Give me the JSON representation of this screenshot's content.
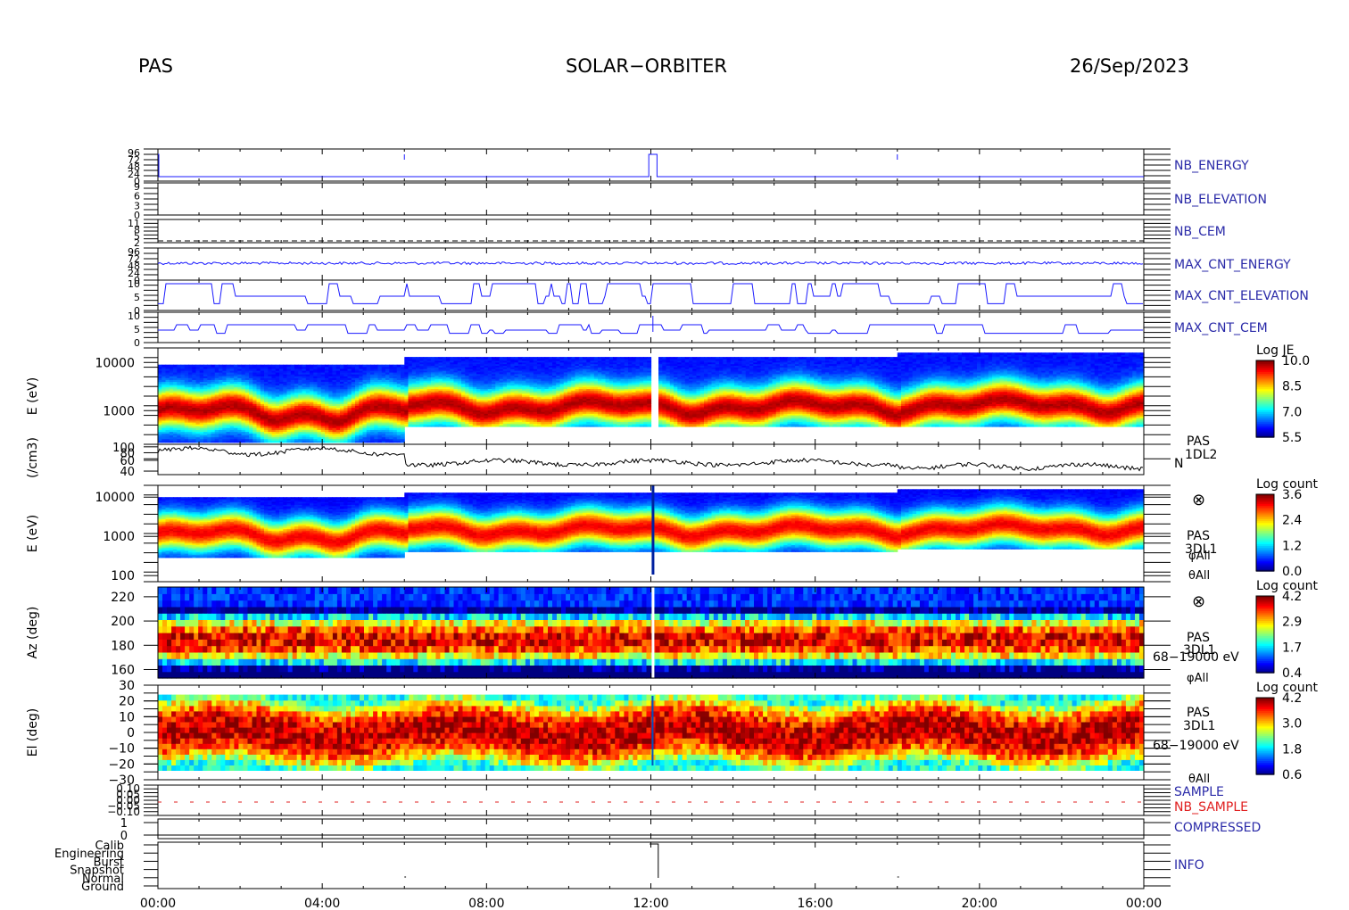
{
  "header": {
    "instrument": "PAS",
    "mission": "SOLAR−ORBITER",
    "date": "26/Sep/2023"
  },
  "colors": {
    "blue_label": "#2a2aa8",
    "red_label": "#e02020",
    "trace": "#1a1aff"
  },
  "chart_data": {
    "type": "heatmap",
    "x_axis": {
      "ticks": [
        "00:00",
        "04:00",
        "08:00",
        "12:00",
        "16:00",
        "20:00",
        "00:00"
      ],
      "range_hours": [
        0,
        24
      ]
    },
    "panels": [
      {
        "id": "nb_energy",
        "kind": "line",
        "label": "NB_ENERGY",
        "label_color": "blue",
        "tick_labels": [
          "96",
          "72",
          "48",
          "24",
          "0"
        ],
        "y_range": [
          0,
          96
        ]
      },
      {
        "id": "nb_elevation",
        "kind": "line",
        "label": "NB_ELEVATION",
        "label_color": "blue",
        "tick_labels": [
          "9",
          "6",
          "3",
          "0"
        ],
        "y_range": [
          0,
          9
        ]
      },
      {
        "id": "nb_cem",
        "kind": "line",
        "label": "NB_CEM",
        "label_color": "blue",
        "tick_labels": [
          "11",
          "8",
          "5",
          "2"
        ],
        "y_range": [
          0,
          11
        ]
      },
      {
        "id": "max_cnt_energy",
        "kind": "line",
        "label": "MAX_CNT_ENERGY",
        "label_color": "blue",
        "tick_labels": [
          "96",
          "72",
          "48",
          "24",
          "0"
        ],
        "y_range": [
          0,
          96
        ]
      },
      {
        "id": "max_cnt_elevation",
        "kind": "line",
        "label": "MAX_CNT_ELEVATION",
        "label_color": "blue",
        "tick_labels": [
          "10",
          "5",
          "0"
        ],
        "y_range": [
          0,
          10
        ]
      },
      {
        "id": "max_cnt_cem",
        "kind": "line",
        "label": "MAX_CNT_CEM",
        "label_color": "blue",
        "tick_labels": [
          "10",
          "5",
          "0"
        ],
        "y_range": [
          0,
          11
        ]
      },
      {
        "id": "energy_je",
        "kind": "spectrogram",
        "ylabel": "E (eV)",
        "y_scale": "log",
        "y_ticks": [
          "10000",
          "1000",
          "100"
        ],
        "y_range": [
          200,
          20000
        ],
        "colorbar": {
          "title": "Log JE",
          "ticks": [
            "10.0",
            "8.5",
            "7.0",
            "5.5"
          ],
          "range": [
            5.5,
            10.0
          ]
        }
      },
      {
        "id": "density",
        "kind": "line",
        "ylabel": "(/cm3)",
        "y_scale": "log",
        "y_ticks": [
          "100",
          "80",
          "60",
          "40"
        ],
        "y_range": [
          35,
          110
        ],
        "right_labels": [
          "PAS",
          "1DL2",
          "N"
        ]
      },
      {
        "id": "energy_count",
        "kind": "spectrogram",
        "ylabel": "E (eV)",
        "y_scale": "log",
        "y_ticks": [
          "10000",
          "1000",
          "100"
        ],
        "y_range": [
          70,
          20000
        ],
        "right_labels": [
          "⊗",
          "PAS",
          "3DL1",
          "φAll",
          "θAll"
        ],
        "colorbar": {
          "title": "Log count",
          "ticks": [
            "3.6",
            "2.4",
            "1.2",
            "0.0"
          ],
          "range": [
            0.0,
            3.6
          ]
        }
      },
      {
        "id": "azimuth",
        "kind": "spectrogram",
        "ylabel": "Az (deg)",
        "y_scale": "linear",
        "y_ticks": [
          "220",
          "200",
          "180",
          "160"
        ],
        "y_range": [
          153,
          228
        ],
        "right_labels": [
          "⊗",
          "PAS",
          "3DL1",
          "68−19000 eV",
          "φAll"
        ],
        "colorbar": {
          "title": "Log count",
          "ticks": [
            "4.2",
            "2.9",
            "1.7",
            "0.4"
          ],
          "range": [
            0.4,
            4.2
          ]
        }
      },
      {
        "id": "elevation",
        "kind": "spectrogram",
        "ylabel": "El (deg)",
        "y_scale": "linear",
        "y_ticks": [
          "30",
          "20",
          "10",
          "0",
          "−10",
          "−20",
          "−30"
        ],
        "y_range": [
          -30,
          30
        ],
        "right_labels": [
          "PAS",
          "3DL1",
          "68−19000 eV",
          "θAll"
        ],
        "colorbar": {
          "title": "Log count",
          "ticks": [
            "4.2",
            "3.0",
            "1.8",
            "0.6"
          ],
          "range": [
            0.6,
            4.2
          ]
        }
      },
      {
        "id": "sample",
        "kind": "line",
        "label": "SAMPLE",
        "label2": "NB_SAMPLE",
        "tick_labels": [
          "0.10",
          "0.05",
          "0.00",
          "−0.05",
          "−0.10"
        ],
        "y_range": [
          -0.1,
          0.1
        ]
      },
      {
        "id": "compressed",
        "kind": "line",
        "label": "COMPRESSED",
        "label_color": "blue",
        "tick_labels": [
          "1",
          "0"
        ],
        "y_range": [
          0,
          1
        ]
      },
      {
        "id": "info",
        "kind": "line",
        "label": "INFO",
        "tick_labels": [
          "Calib",
          "Engineering",
          "Burst",
          "Snapshot",
          "Normal",
          "Ground"
        ]
      }
    ]
  }
}
